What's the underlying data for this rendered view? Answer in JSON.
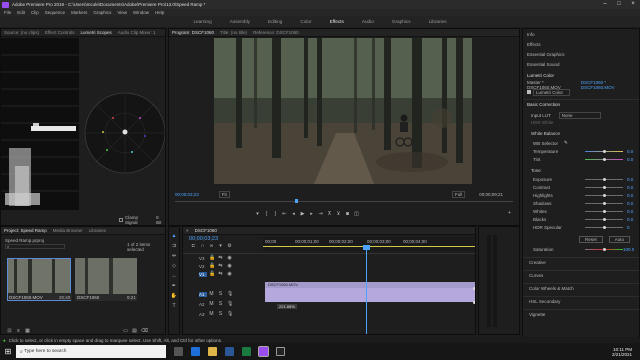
{
  "title_bar": {
    "text": "Adobe Premiere Pro 2019 - C:\\Users\\mcole\\Documents\\Adobe\\Premiere Pro\\13.0\\Speed Ramp *"
  },
  "menu": [
    "File",
    "Edit",
    "Clip",
    "Sequence",
    "Markers",
    "Graphics",
    "View",
    "Window",
    "Help"
  ],
  "workspaces": [
    {
      "label": "Learning",
      "active": false
    },
    {
      "label": "Assembly",
      "active": false
    },
    {
      "label": "Editing",
      "active": false
    },
    {
      "label": "Color",
      "active": false
    },
    {
      "label": "Effects",
      "active": true
    },
    {
      "label": "Audio",
      "active": false
    },
    {
      "label": "Graphics",
      "active": false
    },
    {
      "label": "Libraries",
      "active": false
    }
  ],
  "source_panel": {
    "tabs": [
      "Source: (no clips)",
      "Effect Controls",
      "Lumetri Scopes",
      "Audio Clip Mixer: 1"
    ],
    "clamp_label": "Clamp Signal",
    "bit_label": "8 Bit"
  },
  "program_panel": {
    "tabs": [
      "Program: DSCF1060",
      "Title: (no title)",
      "Reference: DSCF1060"
    ],
    "timecode_left": "00;00;03;23",
    "fit": "Fit",
    "quality": "Full",
    "timecode_right": "00;00;09;21"
  },
  "effects_panel": {
    "tabs": [
      "Info",
      "Effects",
      "Essential Graphics",
      "Essential Sound",
      "Lumetri Color"
    ],
    "master_label": "Master * DSCF1060.MOV",
    "clip_label": "DSCF1060 * DSCF1060.MOV",
    "effect_name": "Lumetri Color",
    "basic_correction": "Basic Correction",
    "input_lut_label": "Input LUT",
    "input_lut_value": "None",
    "hdr_white_label": "HDR White",
    "white_balance": "White Balance",
    "wb_selector": "WB Selector",
    "temperature": {
      "label": "Temperature",
      "value": "0.0"
    },
    "tint": {
      "label": "Tint",
      "value": "0.0"
    },
    "tone": "Tone",
    "tone_rows": [
      {
        "label": "Exposure",
        "value": "0.0"
      },
      {
        "label": "Contrast",
        "value": "0.0"
      },
      {
        "label": "Highlights",
        "value": "0.0"
      },
      {
        "label": "Shadows",
        "value": "0.0"
      },
      {
        "label": "Whites",
        "value": "0.0"
      },
      {
        "label": "Blacks",
        "value": "0.0"
      },
      {
        "label": "HDR Specular",
        "value": "0"
      }
    ],
    "reset_label": "Reset",
    "auto_label": "Auto",
    "saturation": {
      "label": "Saturation",
      "value": "100.0"
    },
    "sections": [
      "Creative",
      "Curves",
      "Color Wheels & Match",
      "HSL Secondary",
      "Vignette"
    ]
  },
  "project_panel": {
    "tabs": [
      "Project: Speed Ramp",
      "Media Browser",
      "Libraries"
    ],
    "project_file": "Speed Ramp.prproj",
    "selection_text": "1 of 2 items selected",
    "items": [
      {
        "name": "DSCF1060.MOV",
        "duration": "20;40"
      },
      {
        "name": "DSCF1060",
        "duration": "9;21"
      }
    ]
  },
  "timeline_panel": {
    "tab": "DSCF1060",
    "timecode": "00;00;03;23",
    "ruler": [
      "00;00",
      "00;00;01;00",
      "00;00;02;00",
      "00;00;03;00",
      "00;00;04;00"
    ],
    "video_tracks": [
      "V3",
      "V2",
      "V1"
    ],
    "audio_tracks": [
      "A1",
      "A2",
      "A3"
    ],
    "clip_label": "DSCF1060.MOV",
    "speed_label": "221.88%"
  },
  "status_bar": {
    "text": "Click to select, or click in empty space and drag to marquee select. Use Shift, Alt, and Ctrl for other options."
  },
  "taskbar": {
    "search_placeholder": "Type here to search",
    "time": "10:11 PM",
    "date": "2/21/2021"
  }
}
